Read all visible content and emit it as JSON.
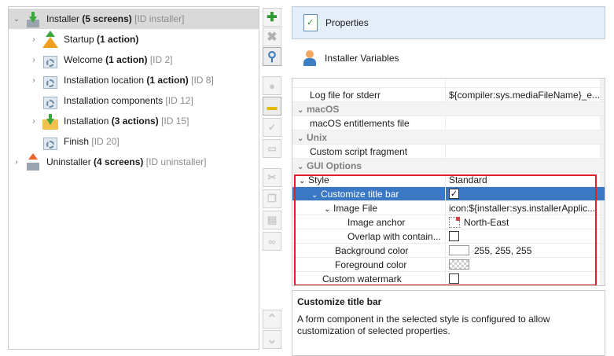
{
  "tree": {
    "items": [
      {
        "name": "installer",
        "label": "Installer",
        "bold": "(5 screens)",
        "id": "[ID installer]",
        "chevron": "down",
        "icon": "installer-icon"
      },
      {
        "name": "startup",
        "label": "Startup",
        "bold": "(1 action)",
        "id": "",
        "chevron": "right",
        "icon": "startup-icon"
      },
      {
        "name": "welcome",
        "label": "Welcome",
        "bold": "(1 action)",
        "id": "[ID 2]",
        "chevron": "right",
        "icon": "screen-icon"
      },
      {
        "name": "installation-location",
        "label": "Installation location",
        "bold": "(1 action)",
        "id": "[ID 8]",
        "chevron": "right",
        "icon": "screen-icon"
      },
      {
        "name": "installation-components",
        "label": "Installation components",
        "bold": "",
        "id": "[ID 12]",
        "chevron": "",
        "icon": "screen-icon"
      },
      {
        "name": "installation",
        "label": "Installation",
        "bold": "(3 actions)",
        "id": "[ID 15]",
        "chevron": "right",
        "icon": "installation-icon"
      },
      {
        "name": "finish",
        "label": "Finish",
        "bold": "",
        "id": "[ID 20]",
        "chevron": "",
        "icon": "screen-icon"
      },
      {
        "name": "uninstaller",
        "label": "Uninstaller",
        "bold": "(4 screens)",
        "id": "[ID uninstaller]",
        "chevron": "right",
        "icon": "uninstaller-icon"
      }
    ]
  },
  "toolbar": {
    "add": "✚",
    "remove": "✖",
    "search": "⚲",
    "comment": "●",
    "note": "▬",
    "check": "✓",
    "folder": "▭",
    "cut": "✂",
    "copy": "❐",
    "paste": "▤",
    "link": "∞",
    "up": "⌃",
    "down": "⌄"
  },
  "right": {
    "properties_label": "Properties",
    "variables_label": "Installer Variables"
  },
  "grid": {
    "rows": [
      {
        "type": "prop",
        "key": "",
        "value": "",
        "checkbox": "partial"
      },
      {
        "type": "prop",
        "key": "Log file for stderr",
        "value": "${compiler:sys.mediaFileName}_e..."
      },
      {
        "type": "cat",
        "key": "macOS"
      },
      {
        "type": "prop",
        "key": "macOS entitlements file",
        "value": ""
      },
      {
        "type": "cat",
        "key": "Unix"
      },
      {
        "type": "prop",
        "key": "Custom script fragment",
        "value": ""
      },
      {
        "type": "cat",
        "key": "GUI Options"
      },
      {
        "type": "prop",
        "key": "Style",
        "value": "Standard",
        "indent": 1
      },
      {
        "type": "sel",
        "key": "Customize title bar",
        "checkbox": "checked",
        "indent": 2
      },
      {
        "type": "prop",
        "key": "Image File",
        "value": "icon:${installer:sys.installerApplic...",
        "indent": 3
      },
      {
        "type": "prop",
        "key": "Image anchor",
        "value": "North-East",
        "anchor": true,
        "indent": 4
      },
      {
        "type": "prop",
        "key": "Overlap with contain...",
        "checkbox": "unchecked",
        "indent": 4
      },
      {
        "type": "prop",
        "key": "Background color",
        "value": "255, 255, 255",
        "swatch": "#ffffff",
        "indent": 3
      },
      {
        "type": "prop",
        "key": "Foreground color",
        "value": "",
        "checker": true,
        "indent": 3
      },
      {
        "type": "prop",
        "key": "Custom watermark",
        "checkbox": "unchecked",
        "indent": 2
      }
    ]
  },
  "description": {
    "title": "Customize title bar",
    "text": "A form component in the selected style is configured to allow customization of selected properties."
  },
  "colors": {
    "selection": "#3a78c3",
    "highlight_box": "#e0202a"
  }
}
